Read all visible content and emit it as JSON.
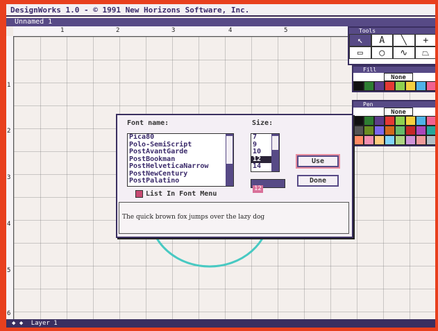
{
  "app": {
    "title": "DesignWorks 1.0 - © 1991 New Horizons Software, Inc.",
    "document_title": "Unnamed 1",
    "status": "Layer 1"
  },
  "ruler": {
    "top_ticks": [
      "1",
      "2",
      "3",
      "4",
      "5"
    ],
    "left_ticks": [
      "1",
      "2",
      "3",
      "4",
      "5",
      "6"
    ]
  },
  "tools_palette": {
    "title": "Tools",
    "tools": [
      {
        "name": "arrow-tool",
        "glyph": "↖"
      },
      {
        "name": "text-tool",
        "glyph": "A"
      },
      {
        "name": "line-tool",
        "glyph": "╲"
      },
      {
        "name": "crosshair-tool",
        "glyph": "+"
      },
      {
        "name": "rectangle-tool",
        "glyph": "▭"
      },
      {
        "name": "oval-tool",
        "glyph": "◯"
      },
      {
        "name": "curve-tool",
        "glyph": "∿"
      },
      {
        "name": "polygon-tool",
        "glyph": "⏢"
      }
    ]
  },
  "fill_palette": {
    "title": "Fill",
    "none_label": "None",
    "colors": [
      "#111111",
      "#2e7d32",
      "#5c3d8a",
      "#e53935",
      "#8fd14f",
      "#f4d03f",
      "#4fb3e8",
      "#f06292"
    ]
  },
  "pen_palette": {
    "title": "Pen",
    "none_label": "None",
    "colors": [
      "#111111",
      "#2e7d32",
      "#5c3d8a",
      "#e53935",
      "#8fd14f",
      "#f4d03f",
      "#4fb3e8",
      "#f06292",
      "#555555",
      "#6b8e23",
      "#7b68ee",
      "#d2691e",
      "#66bb6a",
      "#c62828",
      "#ab47bc",
      "#26a69a",
      "#ff8a65",
      "#f48fb1",
      "#ffcc80",
      "#81d4fa",
      "#aed581",
      "#ce93d8",
      "#ef9a9a",
      "#b0bec5"
    ]
  },
  "dialog": {
    "font_name_label": "Font name:",
    "size_label": "Size:",
    "fonts": [
      "Pica80",
      "Polo-SemiScript",
      "PostAvantGarde",
      "PostBookman",
      "PostHelveticaNarrow",
      "PostNewCentury",
      "PostPalatino"
    ],
    "sizes": [
      "7",
      "9",
      "10",
      "12",
      "14"
    ],
    "selected_size": "12",
    "size_value": "12",
    "use_button": "Use",
    "done_button": "Done",
    "list_in_font_menu": "List In Font Menu",
    "preview_text": "The quick brown fox jumps over the lazy dog"
  },
  "canvas": {
    "circle_color": "#48c9c2"
  }
}
